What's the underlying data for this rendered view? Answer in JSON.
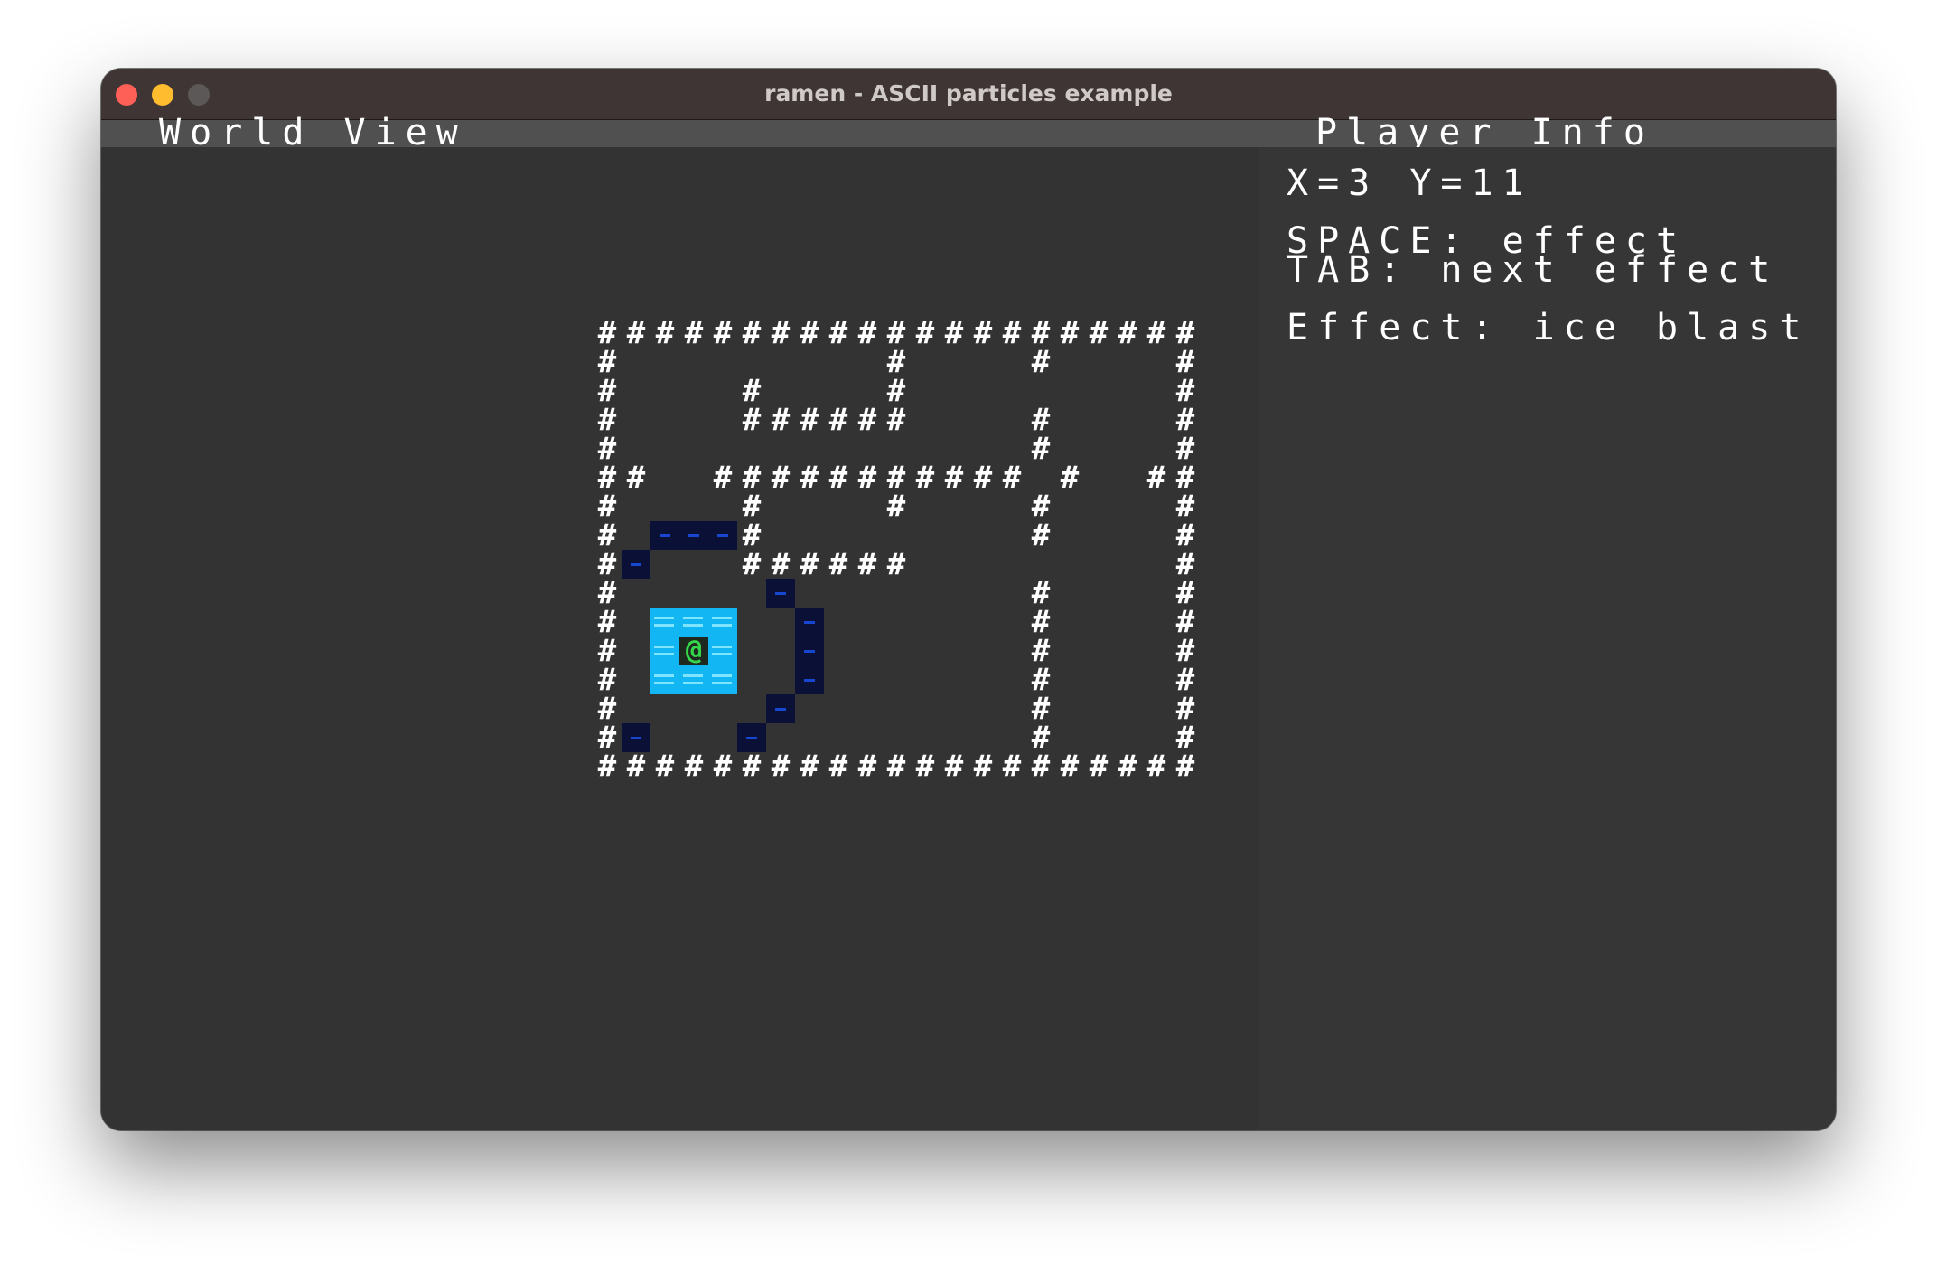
{
  "window": {
    "title": "ramen - ASCII particles example"
  },
  "world": {
    "header": "World View",
    "wall_glyph": "#",
    "player_glyph": "@",
    "map_rows": [
      "#####################",
      "#         #    #    #",
      "#    #    #         #",
      "#    ######    #    #",
      "#              #    #",
      "##  ###########@#  ##",
      "#    #    #    #    #",
      "#    #         #    #",
      "#    ######         #",
      "#              #    #",
      "#              #    #",
      "#              #    #",
      "#              #    #",
      "#              #    #",
      "#              #    #",
      "#####################"
    ]
  },
  "info": {
    "header": "Player Info",
    "coords": "X=3 Y=11",
    "help_space": "SPACE: effect",
    "help_tab": "TAB: next effect",
    "effect": "Effect: ice blast"
  },
  "colors": {
    "particle_dark": "#0b1036",
    "particle_light": "#12b6f2",
    "player": "#35d64a"
  }
}
